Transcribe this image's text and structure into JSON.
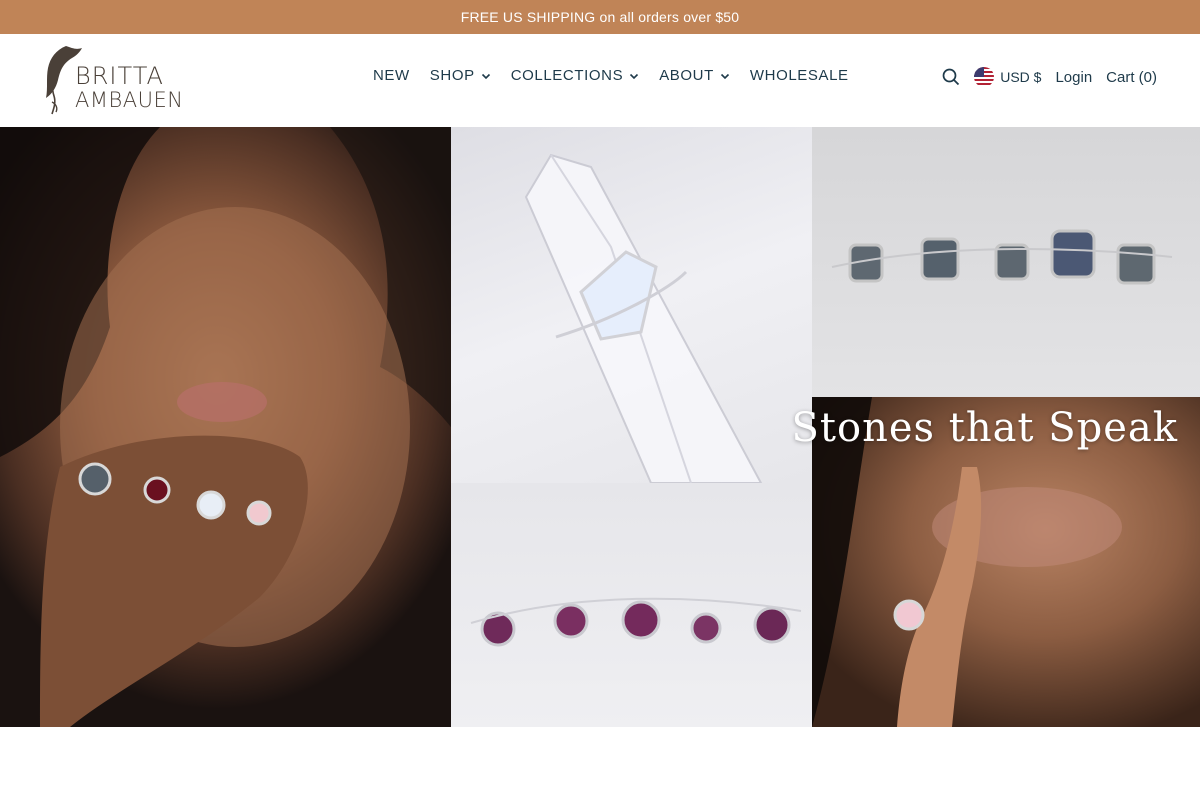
{
  "announcement": {
    "text": "FREE US SHIPPING on all orders over $50"
  },
  "brand": {
    "line1": "BRITTA",
    "line2": "AMBAUEN"
  },
  "nav": {
    "items": [
      {
        "label": "NEW",
        "dropdown": false
      },
      {
        "label": "SHOP",
        "dropdown": true
      },
      {
        "label": "COLLECTIONS",
        "dropdown": true
      },
      {
        "label": "ABOUT",
        "dropdown": true
      },
      {
        "label": "WHOLESALE",
        "dropdown": false
      }
    ]
  },
  "utils": {
    "search_icon": "search-icon",
    "currency": "USD $",
    "login": "Login",
    "cart": "Cart (0)"
  },
  "hero": {
    "title": "Stones that Speak"
  },
  "colors": {
    "announce_bg": "#c08457",
    "nav_text": "#1e3a4a",
    "logo": "#4a4038"
  }
}
